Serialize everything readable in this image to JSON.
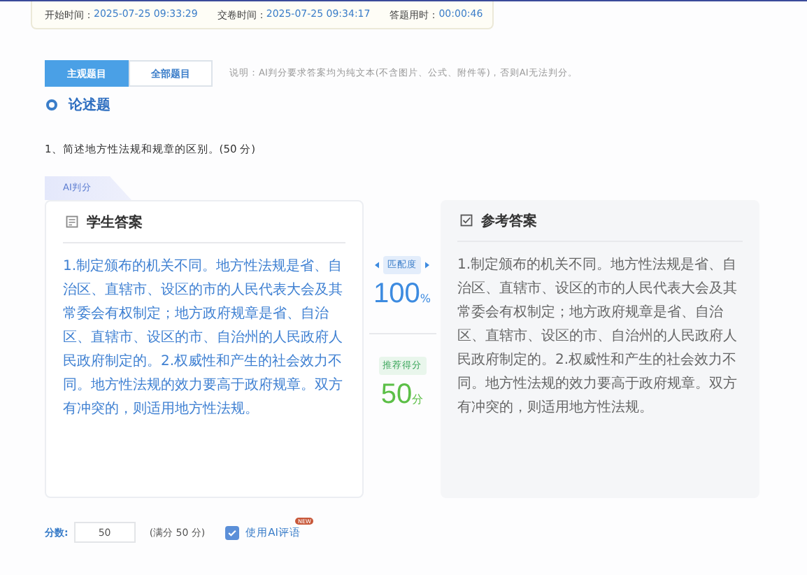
{
  "time_bar": [
    {
      "label": "开始时间：",
      "value": "2025-07-25 09:33:29"
    },
    {
      "label": "交卷时间：",
      "value": "2025-07-25 09:34:17"
    },
    {
      "label": "答题用时：",
      "value": "00:00:46"
    }
  ],
  "tabs": [
    {
      "label": "主观题目",
      "selected": true
    },
    {
      "label": "全部题目",
      "selected": false
    }
  ],
  "note": "说明：AI判分要求答案均为纯文本(不含图片、公式、附件等)，否则AI无法判分。",
  "section_title": "论述题",
  "question": "1、简述地方性法规和规章的区别。(50 分)",
  "ai_tab": "AI判分",
  "student_answer": {
    "title": "学生答案",
    "text": "1.制定颁布的机关不同。地方性法规是省、自治区、直辖市、设区的市的人民代表大会及其常委会有权制定；地方政府规章是省、自治区、直辖市、设区的市、自治州的人民政府人民政府制定的。2.权威性和产生的社会效力不同。地方性法规的效力要高于政府规章。双方有冲突的，则适用地方性法规。"
  },
  "match": {
    "label": "匹配度",
    "value": "100",
    "unit": "%"
  },
  "recommend": {
    "label": "推荐得分",
    "value": "50",
    "unit": "分"
  },
  "reference_answer": {
    "title": "参考答案",
    "text": "1.制定颁布的机关不同。地方性法规是省、自治区、直辖市、设区的市的人民代表大会及其常委会有权制定；地方政府规章是省、自治区、直辖市、设区的市、自治州的人民政府人民政府制定的。2.权威性和产生的社会效力不同。地方性法规的效力要高于政府规章。双方有冲突的，则适用地方性法规。"
  },
  "score": {
    "label": "分数:",
    "value": "50",
    "full": "(满分 50 分)"
  },
  "ai_comment": {
    "label": "使用AI评语",
    "checked": true,
    "badge": "NEW"
  }
}
